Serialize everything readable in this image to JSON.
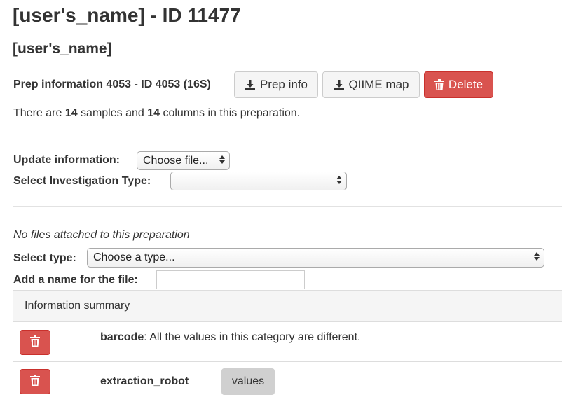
{
  "header": {
    "title": "[user's_name] - ID 11477",
    "subtitle": "[user's_name]"
  },
  "prep": {
    "label": "Prep information 4053 - ID 4053 (16S)",
    "buttons": {
      "prep_info": "Prep info",
      "qiime_map": "QIIME map",
      "delete": "Delete"
    },
    "counts": {
      "prefix": "There are ",
      "samples": "14",
      "middle": " samples and ",
      "columns": "14",
      "suffix": " columns in this preparation."
    }
  },
  "update": {
    "label": "Update information:",
    "file_button": "Choose file..."
  },
  "investigation": {
    "label": "Select Investigation Type:",
    "value": ""
  },
  "files": {
    "status": "No files attached to this preparation",
    "type_label": "Select type:",
    "type_value": "Choose a type...",
    "name_label": "Add a name for the file:",
    "name_value": ""
  },
  "summary": {
    "heading": "Information summary",
    "rows": [
      {
        "name": "barcode",
        "description": ": All the values in this category are different."
      },
      {
        "name": "extraction_robot",
        "values_label": "values"
      }
    ]
  },
  "colors": {
    "danger": "#d9534f",
    "button_bg": "#f5f5f5",
    "panel_bg": "#f5f5f5",
    "values_badge": "#d0d0d0"
  }
}
